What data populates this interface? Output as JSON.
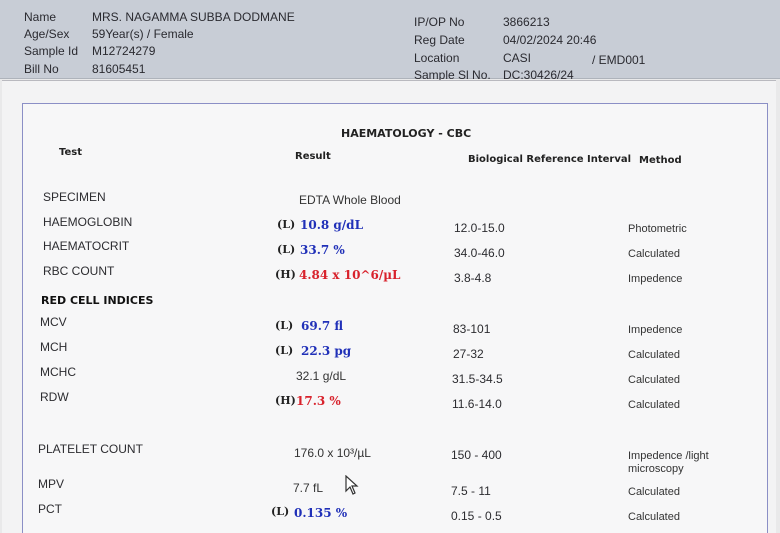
{
  "patient": {
    "name_label": "Name",
    "name": "MRS. NAGAMMA SUBBA DODMANE",
    "age_label": "Age/Sex",
    "age": "59Year(s) / Female",
    "sample_label": "Sample Id",
    "sample": "M12724279",
    "bill_label": "Bill No",
    "bill": "81605451",
    "ipop_label": "IP/OP No",
    "ipop": "3866213",
    "reg_label": "Reg Date",
    "reg": "04/02/2024 20:46",
    "loc_label": "Location",
    "loc": "CASI",
    "loc2": "/ EMD001",
    "slno_label": "Sample Sl No.",
    "slno": "DC:30426/24"
  },
  "report": {
    "title": "HAEMATOLOGY - CBC",
    "col_test": "Test",
    "col_result": "Result",
    "col_ref": "Biological Reference Interval",
    "col_method": "Method"
  },
  "rows": [
    {
      "test": "SPECIMEN",
      "flag": "",
      "result": "EDTA Whole Blood",
      "ref": "",
      "method": ""
    },
    {
      "test": "HAEMOGLOBIN",
      "flag": "(L)",
      "result": "10.8  g/dL",
      "ref": "12.0-15.0",
      "method": "Photometric"
    },
    {
      "test": "HAEMATOCRIT",
      "flag": "(L)",
      "result": "33.7  %",
      "ref": "34.0-46.0",
      "method": "Calculated"
    },
    {
      "test": "RBC COUNT",
      "flag": "(H)",
      "result": "4.84  x 10^6/µL",
      "ref": "3.8-4.8",
      "method": "Impedence"
    },
    {
      "section": "RED CELL INDICES"
    },
    {
      "test": "MCV",
      "flag": "(L)",
      "result": "69.7  fl",
      "ref": "83-101",
      "method": "Impedence"
    },
    {
      "test": "MCH",
      "flag": "(L)",
      "result": "22.3  pg",
      "ref": "27-32",
      "method": "Calculated"
    },
    {
      "test": "MCHC",
      "flag": "",
      "result": "32.1  g/dL",
      "ref": "31.5-34.5",
      "method": "Calculated"
    },
    {
      "test": "RDW",
      "flag": "(H)",
      "result": "17.3  %",
      "ref": "11.6-14.0",
      "method": "Calculated"
    },
    {
      "test": "PLATELET COUNT",
      "flag": "",
      "result": "176.0  x 10³/µL",
      "ref": "150 - 400",
      "method": "Impedence /light",
      "method2": "microscopy"
    },
    {
      "test": "MPV",
      "flag": "",
      "result": "7.7  fL",
      "ref": "7.5 - 11",
      "method": "Calculated"
    },
    {
      "test": "PCT",
      "flag": "(L)",
      "result": "0.135  %",
      "ref": "0.15 - 0.5",
      "method": "Calculated"
    }
  ]
}
